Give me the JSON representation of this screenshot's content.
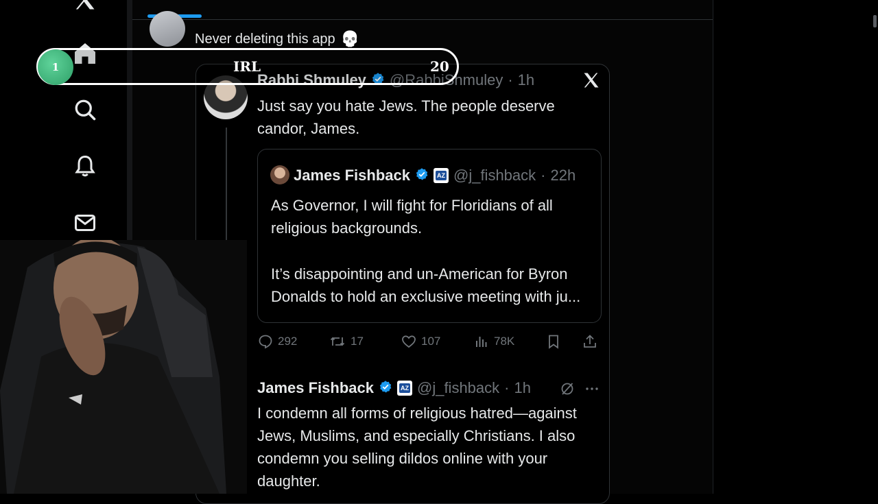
{
  "overlay": {
    "position": "1",
    "label": "IRL",
    "count": "20"
  },
  "parent_post": {
    "text": "Never deleting this app",
    "emoji": "💀"
  },
  "post": {
    "name": "Rabbi Shmuley",
    "handle": "@RabbiShmuley",
    "time": "1h",
    "text_line1": "Just say you hate Jews. The people deserve",
    "text_line2": "candor, James.",
    "quote": {
      "name": "James Fishback",
      "badge": "AZ",
      "handle": "@j_fishback",
      "time": "22h",
      "line1": "As Governor, I will fight for Floridians of all",
      "line2": "religious backgrounds.",
      "line3": "It’s disappointing and un-American for Byron",
      "line4": "Donalds to hold an exclusive meeting with ju..."
    },
    "stats": {
      "replies": "292",
      "reposts": "17",
      "likes": "107",
      "views": "78K"
    }
  },
  "reply": {
    "name": "James Fishback",
    "badge": "AZ",
    "handle": "@j_fishback",
    "time": "1h",
    "line1": "I condemn all forms of religious hatred—against",
    "line2": "Jews, Muslims, and especially Christians. I also",
    "line3": "condemn you selling dildos online with your",
    "line4": "daughter."
  },
  "colors": {
    "verified": "#1d9bf0",
    "accent": "#1d9bf0",
    "overlay_dot": "#3cb878"
  }
}
